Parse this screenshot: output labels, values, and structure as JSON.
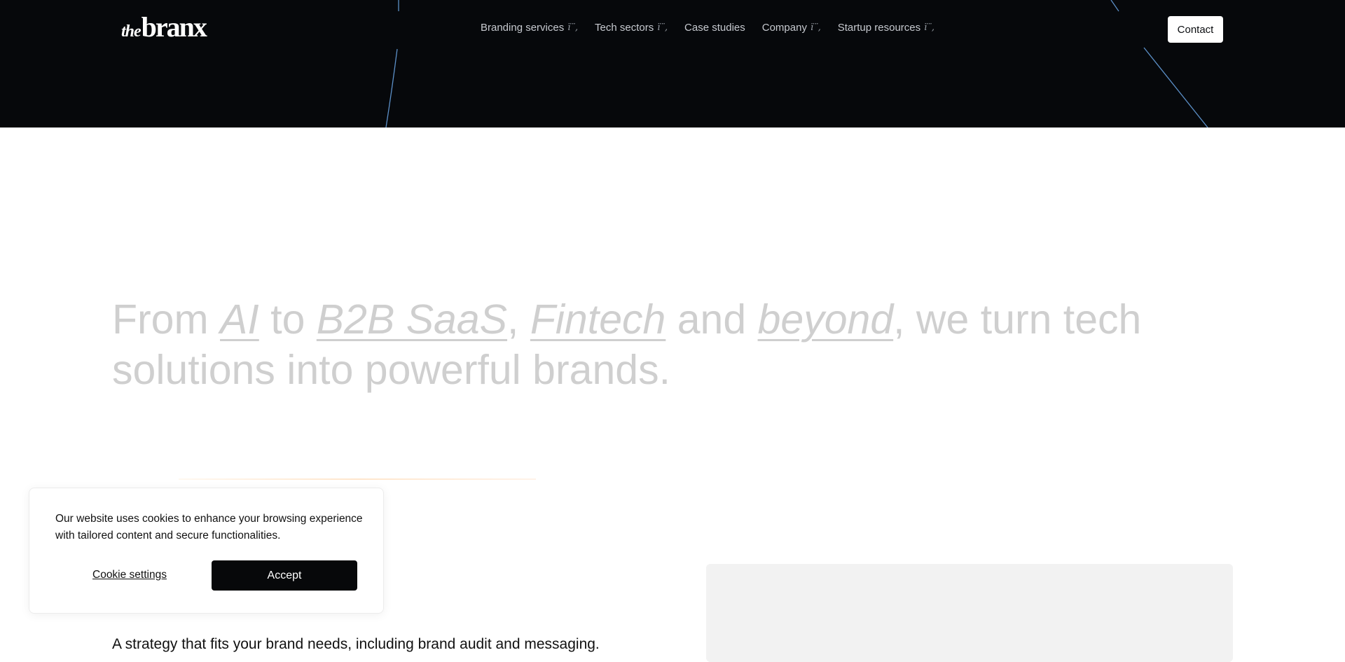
{
  "header": {
    "logo": {
      "prefix": "the",
      "name": "branx"
    },
    "nav": [
      {
        "label": "Branding services",
        "has_dropdown": true
      },
      {
        "label": "Tech sectors",
        "has_dropdown": true
      },
      {
        "label": "Case studies",
        "has_dropdown": false
      },
      {
        "label": "Company",
        "has_dropdown": true
      },
      {
        "label": "Startup resources",
        "has_dropdown": true
      }
    ],
    "dropdown_glyph": "ï¨‚",
    "contact_label": "Contact"
  },
  "hero_colors": {
    "background": "#06080b",
    "accent_arc": "#5b8fc7"
  },
  "headline": {
    "t1": "From ",
    "hl1": "AI",
    "t2": " to ",
    "hl2": "B2B SaaS",
    "t3": ", ",
    "hl3": "Fintech",
    "t4": " and ",
    "hl4": "beyond",
    "t5": ", we turn tech solutions into powerful brands."
  },
  "section": {
    "strategy_text": "A strategy that fits your brand needs, including brand audit and messaging."
  },
  "cookie_banner": {
    "message": "Our website uses cookies to enhance your browsing experience with tailored content and secure functionalities.",
    "settings_label": "Cookie settings",
    "accept_label": "Accept"
  }
}
